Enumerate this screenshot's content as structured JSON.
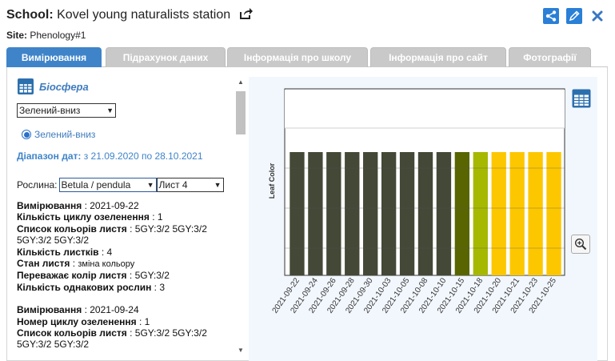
{
  "header": {
    "school_label": "School:",
    "school_name": "Kovel young naturalists station",
    "site_label": "Site:",
    "site_name": "Phenology#1"
  },
  "tabs": [
    {
      "label": "Вимірювання",
      "active": true
    },
    {
      "label": "Підрахунок даних",
      "active": false
    },
    {
      "label": "Інформація про школу",
      "active": false
    },
    {
      "label": "Інформація про сайт",
      "active": false
    },
    {
      "label": "Фотографії",
      "active": false
    }
  ],
  "panel": {
    "title": "Біосфера",
    "protocol_select": "Зелений-вниз",
    "protocol_radio": "Зелений-вниз",
    "date_range_label": "Діапазон дат:",
    "date_range_value": "з 21.09.2020 по 28.10.2021",
    "plant_label": "Рослина:",
    "plant_select": "Betula / pendula",
    "leaf_select": "Лист 4"
  },
  "measurements": [
    {
      "date_label": "Вимірювання",
      "date": "2021-09-22",
      "cycle_label": "Кількість циклу озеленення",
      "cycle": "1",
      "colors_label": "Список кольорів листя",
      "colors": "5GY:3/2 5GY:3/2 5GY:3/2 5GY:3/2",
      "leaves_label": "Кількість листків",
      "leaves": "4",
      "state_label": "Стан листя",
      "state": "зміна кольору",
      "dominant_label": "Переважає колір листя",
      "dominant": "5GY:3/2",
      "same_label": "Кількість однакових рослин",
      "same": "3"
    },
    {
      "date_label": "Вимірювання",
      "date": "2021-09-24",
      "cycle_label": "Номер циклу озеленення",
      "cycle": "1",
      "colors_label": "Список кольорів листя",
      "colors": "5GY:3/2 5GY:3/2 5GY:3/2 5GY:3/2"
    }
  ],
  "chart_data": {
    "type": "bar",
    "ylabel": "Leaf Color",
    "xlabel": "",
    "title": "",
    "categories": [
      "2021-09-22",
      "2021-09-24",
      "2021-09-26",
      "2021-09-28",
      "2021-09-30",
      "2021-10-03",
      "2021-10-05",
      "2021-10-08",
      "2021-10-10",
      "2021-10-15",
      "2021-10-18",
      "2021-10-20",
      "2021-10-21",
      "2021-10-23",
      "2021-10-25"
    ],
    "values": [
      1,
      1,
      1,
      1,
      1,
      1,
      1,
      1,
      1,
      1,
      1,
      1,
      1,
      1,
      1
    ],
    "colors": [
      "#434837",
      "#434837",
      "#434837",
      "#434837",
      "#434837",
      "#434837",
      "#434837",
      "#434837",
      "#434837",
      "#586500",
      "#a6b800",
      "#fdc700",
      "#fdc700",
      "#fdc700",
      "#fdc700"
    ],
    "grid": true
  },
  "icons": {
    "share_out": "share-out-icon",
    "share": "share-icon",
    "edit": "edit-icon",
    "close": "close-icon",
    "table": "table-icon",
    "zoom": "zoom-icon"
  }
}
